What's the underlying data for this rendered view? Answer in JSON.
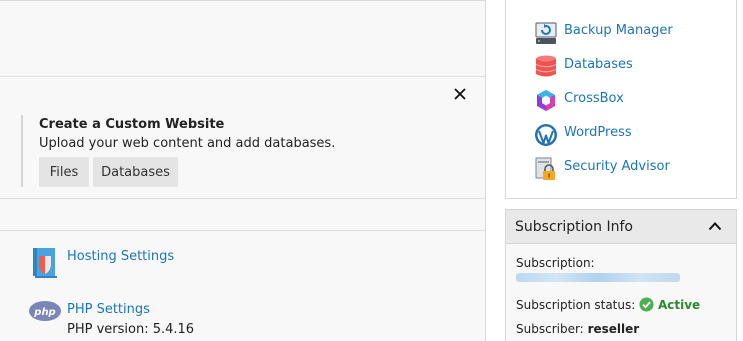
{
  "main": {
    "promo": {
      "title": "Create a Custom Website",
      "subtitle": "Upload your web content and add databases.",
      "buttons": [
        "Files",
        "Databases"
      ]
    },
    "links": {
      "hosting": "Hosting Settings",
      "php": "PHP Settings",
      "php_version": "PHP version: 5.4.16"
    }
  },
  "tools": [
    {
      "label": "Backup Manager",
      "icon": "backup-manager-icon"
    },
    {
      "label": "Databases",
      "icon": "databases-icon"
    },
    {
      "label": "CrossBox",
      "icon": "crossbox-icon"
    },
    {
      "label": "WordPress",
      "icon": "wordpress-icon"
    },
    {
      "label": "Security Advisor",
      "icon": "security-advisor-icon"
    }
  ],
  "subscription": {
    "title": "Subscription Info",
    "subscription_label": "Subscription:",
    "status_label": "Subscription status:",
    "status_value": "Active",
    "subscriber_label": "Subscriber:",
    "subscriber_value": "reseller"
  },
  "colors": {
    "link": "#1b75bb",
    "active": "#2b8a2b",
    "panel_bg": "#f8f8f8"
  }
}
